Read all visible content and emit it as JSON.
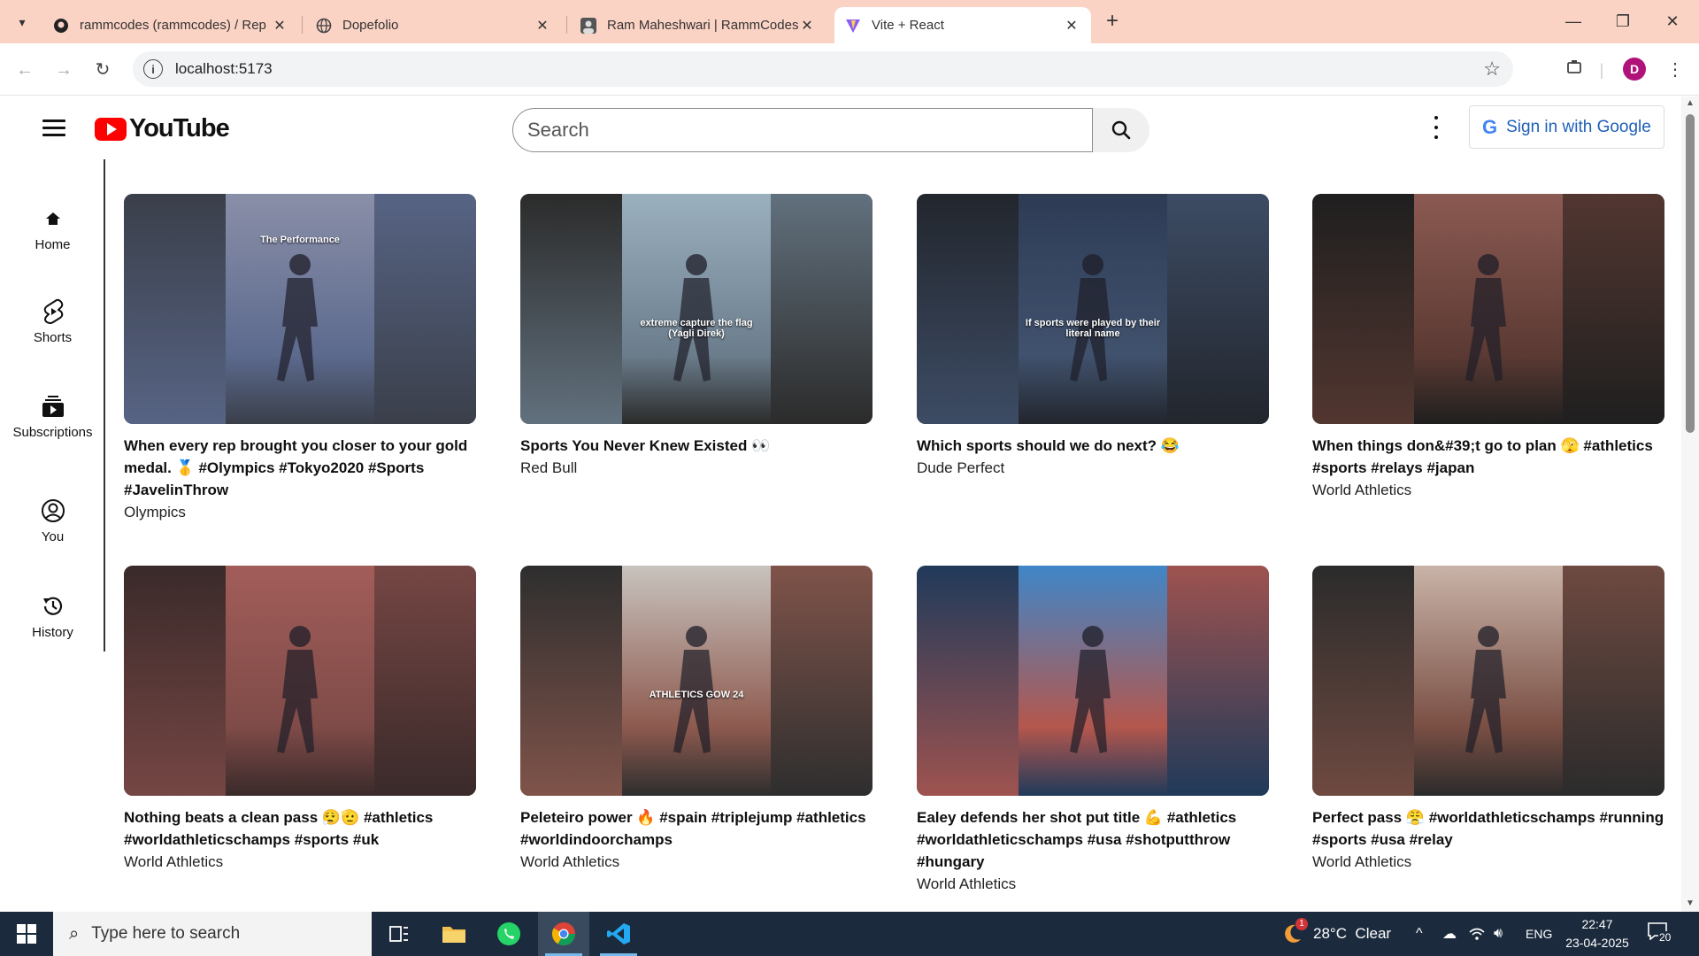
{
  "browser": {
    "tabs": [
      {
        "title": "rammcodes (rammcodes) / Rep",
        "favicon": "github-icon"
      },
      {
        "title": "Dopefolio",
        "favicon": "globe-icon"
      },
      {
        "title": "Ram Maheshwari | RammCodes",
        "favicon": "profile-icon"
      },
      {
        "title": "Vite + React",
        "favicon": "vite-icon",
        "active": true
      }
    ],
    "url": "localhost:5173",
    "profile_initial": "D"
  },
  "youtube": {
    "logo_text": "YouTube",
    "search_placeholder": "Search",
    "signin_label": "Sign in with Google",
    "sidebar": [
      {
        "label": "Home",
        "icon": "home-icon"
      },
      {
        "label": "Shorts",
        "icon": "shorts-icon"
      },
      {
        "label": "Subscriptions",
        "icon": "subscriptions-icon"
      },
      {
        "label": "You",
        "icon": "user-icon"
      },
      {
        "label": "History",
        "icon": "history-icon"
      }
    ],
    "videos": [
      {
        "title": "When every rep brought you closer to your gold medal. 🥇 #Olympics #Tokyo2020 #Sports #JavelinThrow",
        "channel": "Olympics",
        "overlay": "The Performance",
        "colors": [
          "#3a3f4a",
          "#8a8fa8",
          "#5c6a8e"
        ]
      },
      {
        "title": "Sports You Never Knew Existed 👀",
        "channel": "Red Bull",
        "overlay": "extreme capture the flag (Yagli Direk)",
        "colors": [
          "#2b2b2b",
          "#9bb0bf",
          "#6b7d8c"
        ]
      },
      {
        "title": "Which sports should we do next? 😂",
        "channel": "Dude Perfect",
        "overlay": "If sports were played by their literal name",
        "colors": [
          "#22262d",
          "#2d3b55",
          "#41526e"
        ]
      },
      {
        "title": "When things don&#39;t go to plan 🫣 #athletics #sports #relays #japan",
        "channel": "World Athletics",
        "overlay": "",
        "colors": [
          "#1f1f1f",
          "#8b5a52",
          "#5b3a33"
        ]
      },
      {
        "title": "Nothing beats a clean pass 😮‍💨🫡 #athletics #worldathleticschamps #sports #uk",
        "channel": "World Athletics",
        "overlay": "",
        "colors": [
          "#3a2a2a",
          "#a25d59",
          "#7f4b48"
        ]
      },
      {
        "title": "Peleteiro power 🔥 #spain #triplejump #athletics #worldindoorchamps",
        "channel": "World Athletics",
        "overlay": "ATHLETICS GOW 24",
        "colors": [
          "#2e2e2e",
          "#c8c3be",
          "#8e5a4f"
        ]
      },
      {
        "title": "Ealey defends her shot put title 💪 #athletics #worldathleticschamps #usa #shotputthrow #hungary",
        "channel": "World Athletics",
        "overlay": "",
        "colors": [
          "#203a5a",
          "#3f86c8",
          "#b4574d"
        ]
      },
      {
        "title": "Perfect pass 😤 #worldathleticschamps #running #sports #usa #relay",
        "channel": "World Athletics",
        "overlay": "",
        "colors": [
          "#2b2b2b",
          "#c9b3a8",
          "#7a4f44"
        ]
      }
    ]
  },
  "taskbar": {
    "search_placeholder": "Type here to search",
    "weather": "28°C  Clear",
    "language": "ENG",
    "time": "22:47",
    "date": "23-04-2025",
    "notification_count": "20",
    "weather_badge": "1"
  }
}
